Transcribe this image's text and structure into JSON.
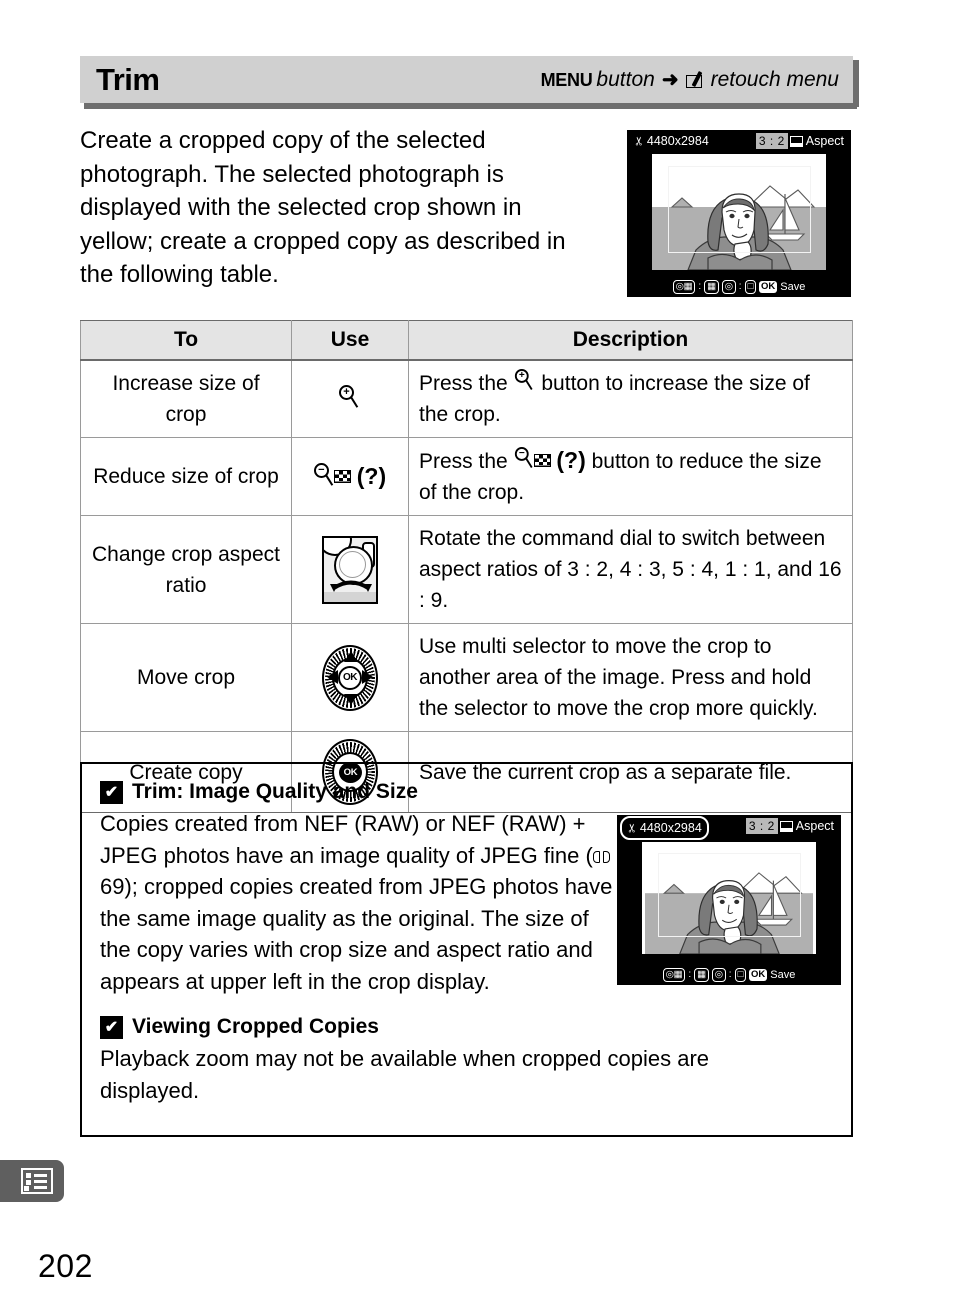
{
  "header": {
    "title": "Trim",
    "menu_label": "MENU",
    "button_word": "button",
    "arrow": "➜",
    "menu_target": "retouch menu",
    "retouch_icon": "retouch-pen-icon"
  },
  "intro": {
    "paragraph": "Create a cropped copy of the selected photograph.  The selected photograph is displayed with the selected crop shown in yellow; create a cropped copy as described in the following table."
  },
  "monitor_top": {
    "image_size": "4480x2984",
    "scissors_icon": "scissors-icon",
    "ratio": "3 : 2",
    "aspect_label": "Aspect",
    "footer_hint_1": "Q",
    "footer_hint_sep": ":",
    "footer_hint_2": "Q",
    "ok_label": "OK",
    "save_label": "Save"
  },
  "table": {
    "headers": [
      "To",
      "Use",
      "Description"
    ],
    "rows": [
      {
        "to": "Increase size of crop",
        "use_icon": "magnify-plus-icon",
        "use_label": "",
        "description_pre": "Press the ",
        "description_post": " button to increase the size of the crop."
      },
      {
        "to": "Reduce size of crop",
        "use_icon": "magnify-minus-thumbnail-help-icon",
        "use_label": "(?)",
        "description_pre": "Press the ",
        "description_post": " button to reduce the size of the crop."
      },
      {
        "to": "Change crop aspect ratio",
        "use_icon": "command-dial-icon",
        "use_label": "",
        "description_full": "Rotate the command dial to switch between aspect ratios of 3 : 2, 4 : 3, 5 : 4, 1 : 1, and 16 : 9."
      },
      {
        "to": "Move crop",
        "use_icon": "multi-selector-icon",
        "use_label": "",
        "description_full": "Use multi selector to move the crop to another area of the image.  Press and hold the selector to move the crop more quickly."
      },
      {
        "to": "Create copy",
        "use_icon": "ok-button-icon",
        "use_label": "",
        "description_full": "Save the current crop as a separate file."
      }
    ]
  },
  "notes": [
    {
      "badge": "check-badge-icon",
      "title": "Trim: Image Quality and Size",
      "body_part1": "Copies created from NEF (RAW) or NEF (RAW) + JPEG photos have an image quality of JPEG fine (",
      "page_ref": "69",
      "body_part2": "); cropped copies created from JPEG photos have the same image quality as the original.  The size of the copy varies with crop size and aspect ratio and appears at upper left in the crop display."
    },
    {
      "badge": "check-badge-icon",
      "title": "Viewing Cropped Copies",
      "body_full": "Playback zoom may not be available when cropped copies are displayed."
    }
  ],
  "monitor_note": {
    "image_size": "4480x2984",
    "scissors_icon": "scissors-icon",
    "ratio": "3 : 2",
    "aspect_label": "Aspect",
    "ok_label": "OK",
    "save_label": "Save"
  },
  "footer": {
    "page_number": "202",
    "tab_icon": "menu-list-icon"
  },
  "colors": {
    "header_band": "#d0d0d0",
    "header_shadow": "#6e6e6e",
    "table_header_bg": "#e4e4e4",
    "table_border": "#9a9a9a",
    "tab_marker": "#5f5f5f"
  }
}
